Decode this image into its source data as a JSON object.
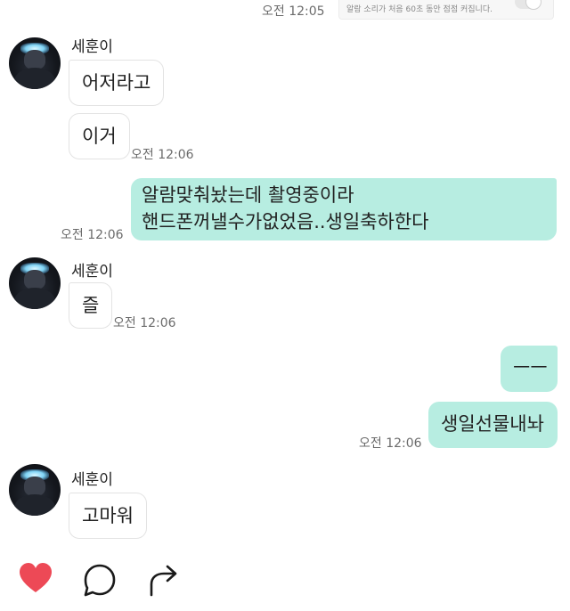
{
  "top": {
    "time": "오전 12:05",
    "notice_text": "알람 소리가 처음 60초 동안 점점 커집니다."
  },
  "messages": [
    {
      "sender": "세훈이",
      "bubbles": [
        "어저라고",
        "이거"
      ],
      "time": "오전 12:06"
    },
    {
      "mine": true,
      "lines": [
        "알람맞춰놨는데 촬영중이라",
        "핸드폰꺼낼수가없었음..생일축하한다"
      ],
      "time": "오전 12:06"
    },
    {
      "sender": "세훈이",
      "bubbles": [
        "즐"
      ],
      "time": "오전 12:06"
    },
    {
      "mine": true,
      "bubbles": [
        "ㅡㅡ",
        "생일선물내놔"
      ],
      "time": "오전 12:06"
    },
    {
      "sender": "세훈이",
      "bubbles": [
        "고마워"
      ]
    }
  ],
  "actions": {
    "like_icon": "heart-icon",
    "comment_icon": "comment-icon",
    "share_icon": "share-icon"
  },
  "colors": {
    "my_bubble": "#b7ede1",
    "heart": "#ed4956"
  }
}
